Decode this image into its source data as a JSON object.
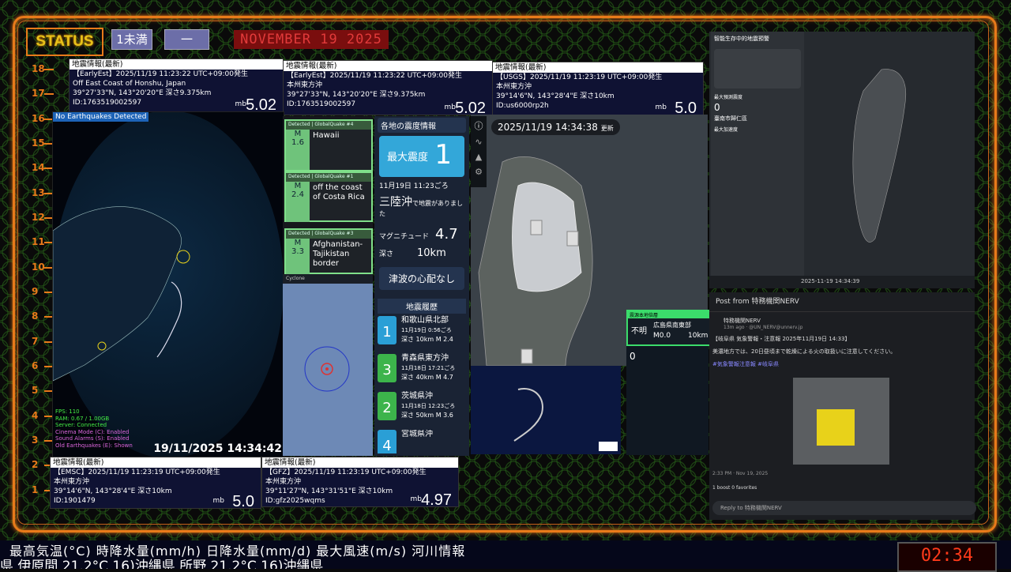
{
  "status_label": "STATUS",
  "badge_intensity": "1未満",
  "badge_dash": "一",
  "date_banner": "NOVEMBER 19 2025",
  "scale_ticks": [
    "18",
    "17",
    "16",
    "15",
    "14",
    "13",
    "12",
    "11",
    "10",
    "9",
    "8",
    "7",
    "6",
    "5",
    "4",
    "3",
    "2",
    "1"
  ],
  "panels": {
    "p1": {
      "header": "地震情報(最新)",
      "l1": "【EarlyEst】2025/11/19 11:23:22 UTC+09:00発生",
      "l2": "Off East Coast of Honshu, Japan",
      "l3": "39°27'33\"N, 143°20'20\"E 深さ9.375km",
      "l4": "ID:1763519002597",
      "mb": "mb",
      "mag": "5.02"
    },
    "p2": {
      "header": "地震情報(最新)",
      "l1": "【EarlyEst】2025/11/19 11:23:22 UTC+09:00発生",
      "l2": "本州東方沖",
      "l3": "39°27'33\"N, 143°20'20\"E 深さ9.375km",
      "l4": "ID:1763519002597",
      "mb": "mb",
      "mag": "5.02"
    },
    "p3": {
      "header": "地震情報(最新)",
      "l1": "【USGS】2025/11/19 11:23:19 UTC+09:00発生",
      "l2": "本州東方沖",
      "l3": "39°14'6\"N, 143°28'4\"E 深さ10km",
      "l4": "ID:us6000rp2h",
      "mb": "mb",
      "mag": "5.0"
    },
    "p4": {
      "header": "地震情報(最新)",
      "l1": "【EMSC】2025/11/19 11:23:19 UTC+09:00発生",
      "l2": "本州東方沖",
      "l3": "39°14'6\"N, 143°28'4\"E 深さ10km",
      "l4": "ID:1901479",
      "mb": "mb",
      "mag": "5.0"
    },
    "p5": {
      "header": "地震情報(最新)",
      "l1": "【GFZ】2025/11/19 11:23:19 UTC+09:00発生",
      "l2": "本州東方沖",
      "l3": "39°11'27\"N, 143°31'51\"E 深さ10km",
      "l4": "ID:gfz2025wqms",
      "mb": "mb",
      "mag": "4.97"
    }
  },
  "globe": {
    "tag": "No Earthquakes Detected",
    "stats": [
      "FPS: 110",
      "RAM: 0.67 / 1.00GB",
      "Server: Connected",
      "Cinema Mode (C): Enabled",
      "Sound Alarms (S): Enabled",
      "Old Earthquakes (E): Shown"
    ],
    "clock": "19/11/2025 14:34:42"
  },
  "detect": [
    {
      "top": "Detected | GlobalQuake  #4",
      "m": "M",
      "val": "1.6",
      "name": "Hawaii"
    },
    {
      "top": "Detected | GlobalQuake  #1",
      "m": "M",
      "val": "2.4",
      "name": "off the coast of Costa Rica"
    },
    {
      "top": "Detected | GlobalQuake  #3",
      "m": "M",
      "val": "3.3",
      "name": "Afghanistan-Tajikistan border"
    }
  ],
  "cyclone_label": "Cyclone",
  "jma": {
    "header": "各地の震度情報",
    "max_label": "最大震度",
    "max_value": "1",
    "time": "11月19日 11:23ごろ",
    "place": "三陸沖",
    "place_suffix": "で地震がありました",
    "mag_label": "マグニチュード",
    "mag": "4.7",
    "depth_label": "深さ",
    "depth": "10km",
    "tsunami": "津波の心配なし"
  },
  "history": {
    "title": "地震履歴",
    "rows": [
      {
        "max": "1",
        "place": "和歌山県北部",
        "time": "11月19日 0:56ごろ",
        "depth": "深さ 10km",
        "mag": "M 2.4",
        "color": "#2a9fd6"
      },
      {
        "max": "3",
        "place": "青森県東方沖",
        "time": "11月18日 17:21ごろ",
        "depth": "深さ 40km",
        "mag": "M 4.7",
        "color": "#3cb44b"
      },
      {
        "max": "2",
        "place": "茨城県沖",
        "time": "11月18日 12:23ごろ",
        "depth": "深さ 50km",
        "mag": "M 3.6",
        "color": "#3cb44b"
      },
      {
        "max": "4",
        "place": "宮城県沖",
        "time": "11月18日 12:03ごろ",
        "depth": "",
        "mag": "",
        "color": "#2a9fd6"
      }
    ]
  },
  "map": {
    "time": "2025/11/19 14:34:38",
    "suffix": "更新",
    "scale_icon": "1"
  },
  "shindo": {
    "title": "震源本地倍層",
    "unk": "不明",
    "place": "広島県南東部",
    "mag": "M0.0",
    "depth": "10km",
    "zero": "0"
  },
  "taiwan": {
    "title": "智能生存中的地震預警",
    "label1": "最大預測震度",
    "val1": "0",
    "city": "臺南市歸仁區",
    "label2": "最大加速度",
    "time": "2025-11-19 14:34:39"
  },
  "post": {
    "header": "Post from 特務機関NERV",
    "user": "特務機関NERV",
    "handle": "13m ago · @UN_NERV@unnerv.jp",
    "text1": "【岐阜県 気象警報・注意報 2025年11月19日 14:33】",
    "text2": "美濃地方では、20日昼頃まで乾燥による火の取扱いに注意してください。",
    "tags": "#気象警報注意報 #岐阜県",
    "footer": "2:33 PM · Nov 19, 2025",
    "stats": "1 boost  0 favorites",
    "reply": "Reply to 特務機関NERV"
  },
  "ticker": {
    "top": "最高気温(°C)  時降水量(mm/h)  日降水量(mm/d)  最大風速(m/s)  河川情報",
    "bottom": "県 伊原間 21.2°C    16)沖縄県 所野 21.2°C    16)沖縄県"
  },
  "clock": "02:34"
}
